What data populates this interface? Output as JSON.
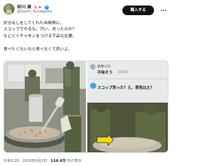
{
  "author": {
    "display_name": "砂川 泉",
    "display_icons": "🌸🇯🇵",
    "handle": "@Izumi_Sunagawa"
  },
  "follow_label": "購入する",
  "tweet": {
    "text": "炊き出しをしてくれた自衛隊に、\nスコップでやるな、汚い、洗ったのか？\nなどとイチャモンをつける下品な左翼。\n\n食べたくないなら食べなくて良いよ。"
  },
  "media": {
    "reply_card": {
      "username": "鍋奉125",
      "reply_line": "不味そう",
      "reply_meta": "3時間前",
      "quote_line": "スコップ洗った？え、茶色は土？"
    }
  },
  "meta": {
    "time": "午後3:28",
    "date": "2026年8月2日",
    "views_count": "116.4万",
    "views_label": "件の表示"
  },
  "colors": {
    "accent": "#1d9bf0",
    "text": "#0f1419",
    "muted": "#536471",
    "arrow": "#f5d90f"
  }
}
